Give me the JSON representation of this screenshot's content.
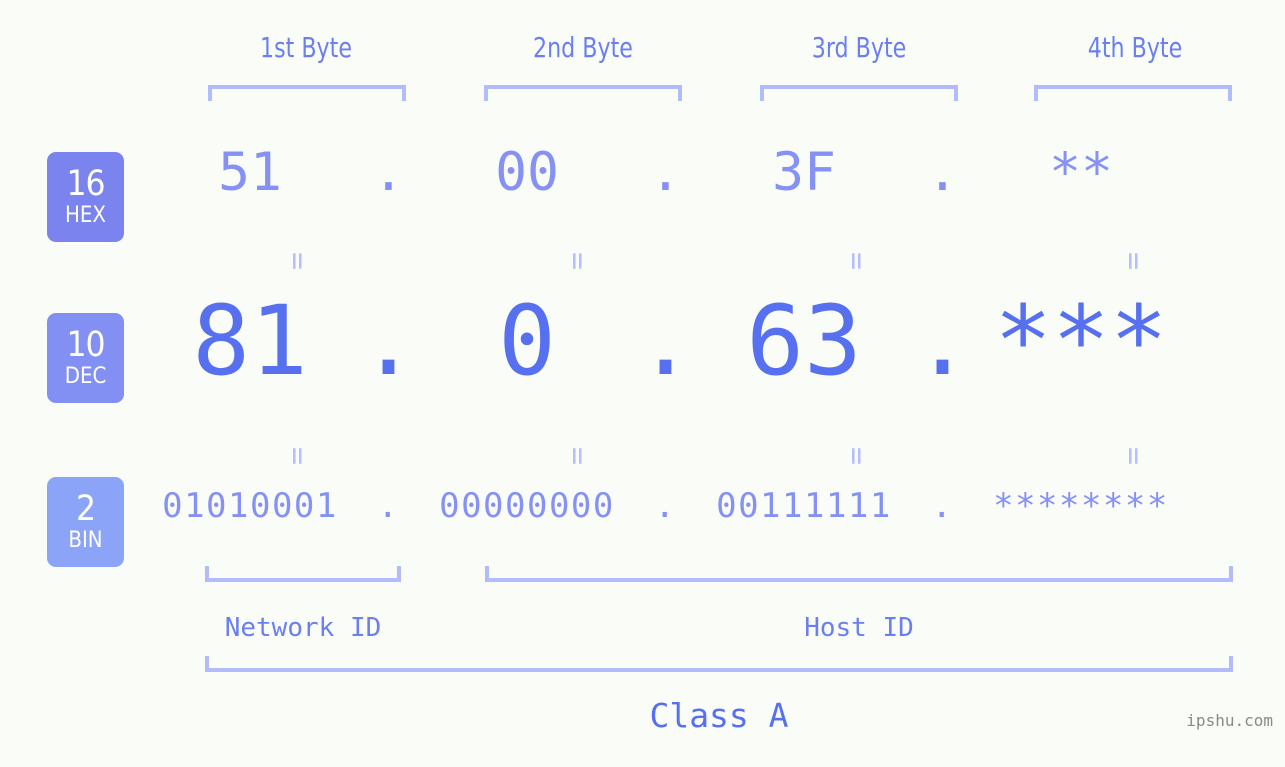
{
  "background": "#fafcf8",
  "colors": {
    "accent_strong": "#5670ef",
    "accent_mid": "#6b7ff0",
    "accent_light": "#8591f4",
    "bracket": "#b2bbfb",
    "badge_hex": "#7b84ee",
    "badge_dec": "#8290f3",
    "badge_bin": "#8ca4f8",
    "watermark": "#8a8a8a"
  },
  "byte_headers": [
    {
      "label": "1st Byte"
    },
    {
      "label": "2nd Byte"
    },
    {
      "label": "3rd Byte"
    },
    {
      "label": "4th Byte"
    }
  ],
  "bases": [
    {
      "num": "16",
      "abbr": "HEX"
    },
    {
      "num": "10",
      "abbr": "DEC"
    },
    {
      "num": "2",
      "abbr": "BIN"
    }
  ],
  "rows": {
    "hex": {
      "base_num": "16",
      "base_abbr": "HEX",
      "octets": [
        "51",
        "00",
        "3F",
        "**"
      ],
      "separators": [
        ".",
        ".",
        "."
      ]
    },
    "dec": {
      "base_num": "10",
      "base_abbr": "DEC",
      "octets": [
        "81",
        "0",
        "63",
        "***"
      ],
      "separators": [
        ".",
        ".",
        "."
      ]
    },
    "bin": {
      "base_num": "2",
      "base_abbr": "BIN",
      "octets": [
        "01010001",
        "00000000",
        "00111111",
        "********"
      ],
      "separators": [
        ".",
        ".",
        "."
      ]
    }
  },
  "equals": {
    "glyph": "=",
    "count_per_gap": 4
  },
  "sections": {
    "network_id": "Network ID",
    "host_id": "Host ID",
    "class": "Class A"
  },
  "watermark": "ipshu.com"
}
